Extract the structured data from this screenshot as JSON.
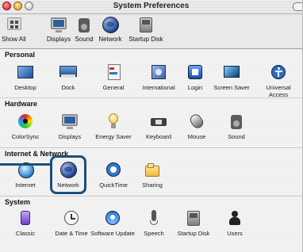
{
  "window": {
    "title": "System Preferences"
  },
  "toolbar": [
    {
      "name": "show-all",
      "label": "Show All"
    },
    {
      "name": "displays",
      "label": "Displays"
    },
    {
      "name": "sound",
      "label": "Sound"
    },
    {
      "name": "network",
      "label": "Network"
    },
    {
      "name": "startup-disk",
      "label": "Startup Disk"
    }
  ],
  "sections": [
    {
      "title": "Personal",
      "items": [
        "Desktop",
        "Dock",
        "General",
        "International",
        "Login",
        "Screen Saver",
        "Universal Access"
      ]
    },
    {
      "title": "Hardware",
      "items": [
        "ColorSync",
        "Displays",
        "Energy Saver",
        "Keyboard",
        "Mouse",
        "Sound"
      ]
    },
    {
      "title": "Internet & Network",
      "items": [
        "Internet",
        "Network",
        "QuickTime",
        "Sharing"
      ]
    },
    {
      "title": "System",
      "items": [
        "Classic",
        "Date & Time",
        "Software Update",
        "Speech",
        "Startup Disk",
        "Users"
      ]
    }
  ],
  "highlight": {
    "target": "Network"
  },
  "icons": {
    "accent_blue": "#1a4f7a"
  }
}
